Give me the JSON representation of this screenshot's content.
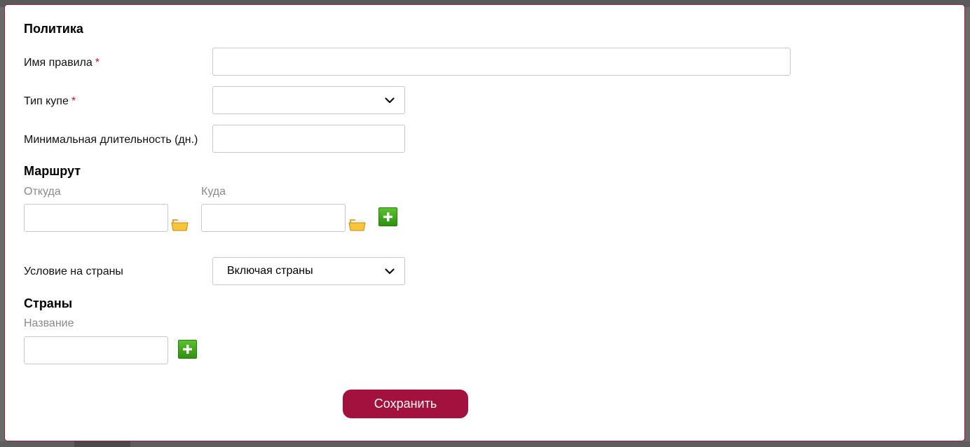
{
  "policy": {
    "title": "Политика",
    "rule_name": {
      "label": "Имя правила",
      "required_mark": "*",
      "value": "",
      "placeholder": ""
    },
    "coupe_type": {
      "label": "Тип купе",
      "required_mark": "*",
      "selected": ""
    },
    "min_duration": {
      "label": "Минимальная длительность (дн.)",
      "value": ""
    }
  },
  "route": {
    "title": "Маршрут",
    "from": {
      "label": "Откуда",
      "value": ""
    },
    "to": {
      "label": "Куда",
      "value": ""
    }
  },
  "country_condition": {
    "label": "Условие на страны",
    "selected": "Включая страны"
  },
  "countries": {
    "title": "Страны",
    "name": {
      "label": "Название",
      "value": ""
    }
  },
  "actions": {
    "save_label": "Сохранить"
  },
  "colors": {
    "accent": "#a3113e",
    "add_green": "#3aa61b",
    "required": "#c0102b"
  },
  "icons": {
    "folder": "folder-icon",
    "add": "plus-icon",
    "chevron": "chevron-down-icon"
  }
}
